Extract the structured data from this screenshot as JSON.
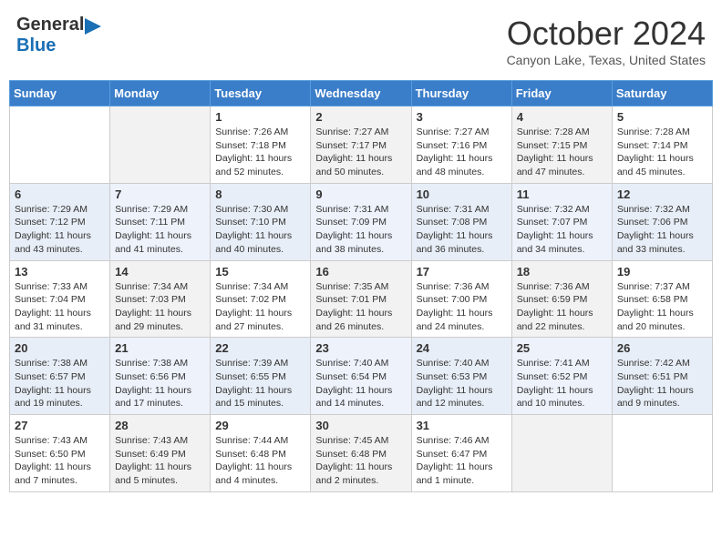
{
  "header": {
    "logo_line1": "General",
    "logo_line2": "Blue",
    "month_title": "October 2024",
    "location": "Canyon Lake, Texas, United States"
  },
  "weekdays": [
    "Sunday",
    "Monday",
    "Tuesday",
    "Wednesday",
    "Thursday",
    "Friday",
    "Saturday"
  ],
  "weeks": [
    [
      {
        "day": "",
        "info": ""
      },
      {
        "day": "",
        "info": ""
      },
      {
        "day": "1",
        "info": "Sunrise: 7:26 AM\nSunset: 7:18 PM\nDaylight: 11 hours and 52 minutes."
      },
      {
        "day": "2",
        "info": "Sunrise: 7:27 AM\nSunset: 7:17 PM\nDaylight: 11 hours and 50 minutes."
      },
      {
        "day": "3",
        "info": "Sunrise: 7:27 AM\nSunset: 7:16 PM\nDaylight: 11 hours and 48 minutes."
      },
      {
        "day": "4",
        "info": "Sunrise: 7:28 AM\nSunset: 7:15 PM\nDaylight: 11 hours and 47 minutes."
      },
      {
        "day": "5",
        "info": "Sunrise: 7:28 AM\nSunset: 7:14 PM\nDaylight: 11 hours and 45 minutes."
      }
    ],
    [
      {
        "day": "6",
        "info": "Sunrise: 7:29 AM\nSunset: 7:12 PM\nDaylight: 11 hours and 43 minutes."
      },
      {
        "day": "7",
        "info": "Sunrise: 7:29 AM\nSunset: 7:11 PM\nDaylight: 11 hours and 41 minutes."
      },
      {
        "day": "8",
        "info": "Sunrise: 7:30 AM\nSunset: 7:10 PM\nDaylight: 11 hours and 40 minutes."
      },
      {
        "day": "9",
        "info": "Sunrise: 7:31 AM\nSunset: 7:09 PM\nDaylight: 11 hours and 38 minutes."
      },
      {
        "day": "10",
        "info": "Sunrise: 7:31 AM\nSunset: 7:08 PM\nDaylight: 11 hours and 36 minutes."
      },
      {
        "day": "11",
        "info": "Sunrise: 7:32 AM\nSunset: 7:07 PM\nDaylight: 11 hours and 34 minutes."
      },
      {
        "day": "12",
        "info": "Sunrise: 7:32 AM\nSunset: 7:06 PM\nDaylight: 11 hours and 33 minutes."
      }
    ],
    [
      {
        "day": "13",
        "info": "Sunrise: 7:33 AM\nSunset: 7:04 PM\nDaylight: 11 hours and 31 minutes."
      },
      {
        "day": "14",
        "info": "Sunrise: 7:34 AM\nSunset: 7:03 PM\nDaylight: 11 hours and 29 minutes."
      },
      {
        "day": "15",
        "info": "Sunrise: 7:34 AM\nSunset: 7:02 PM\nDaylight: 11 hours and 27 minutes."
      },
      {
        "day": "16",
        "info": "Sunrise: 7:35 AM\nSunset: 7:01 PM\nDaylight: 11 hours and 26 minutes."
      },
      {
        "day": "17",
        "info": "Sunrise: 7:36 AM\nSunset: 7:00 PM\nDaylight: 11 hours and 24 minutes."
      },
      {
        "day": "18",
        "info": "Sunrise: 7:36 AM\nSunset: 6:59 PM\nDaylight: 11 hours and 22 minutes."
      },
      {
        "day": "19",
        "info": "Sunrise: 7:37 AM\nSunset: 6:58 PM\nDaylight: 11 hours and 20 minutes."
      }
    ],
    [
      {
        "day": "20",
        "info": "Sunrise: 7:38 AM\nSunset: 6:57 PM\nDaylight: 11 hours and 19 minutes."
      },
      {
        "day": "21",
        "info": "Sunrise: 7:38 AM\nSunset: 6:56 PM\nDaylight: 11 hours and 17 minutes."
      },
      {
        "day": "22",
        "info": "Sunrise: 7:39 AM\nSunset: 6:55 PM\nDaylight: 11 hours and 15 minutes."
      },
      {
        "day": "23",
        "info": "Sunrise: 7:40 AM\nSunset: 6:54 PM\nDaylight: 11 hours and 14 minutes."
      },
      {
        "day": "24",
        "info": "Sunrise: 7:40 AM\nSunset: 6:53 PM\nDaylight: 11 hours and 12 minutes."
      },
      {
        "day": "25",
        "info": "Sunrise: 7:41 AM\nSunset: 6:52 PM\nDaylight: 11 hours and 10 minutes."
      },
      {
        "day": "26",
        "info": "Sunrise: 7:42 AM\nSunset: 6:51 PM\nDaylight: 11 hours and 9 minutes."
      }
    ],
    [
      {
        "day": "27",
        "info": "Sunrise: 7:43 AM\nSunset: 6:50 PM\nDaylight: 11 hours and 7 minutes."
      },
      {
        "day": "28",
        "info": "Sunrise: 7:43 AM\nSunset: 6:49 PM\nDaylight: 11 hours and 5 minutes."
      },
      {
        "day": "29",
        "info": "Sunrise: 7:44 AM\nSunset: 6:48 PM\nDaylight: 11 hours and 4 minutes."
      },
      {
        "day": "30",
        "info": "Sunrise: 7:45 AM\nSunset: 6:48 PM\nDaylight: 11 hours and 2 minutes."
      },
      {
        "day": "31",
        "info": "Sunrise: 7:46 AM\nSunset: 6:47 PM\nDaylight: 11 hours and 1 minute."
      },
      {
        "day": "",
        "info": ""
      },
      {
        "day": "",
        "info": ""
      }
    ]
  ]
}
